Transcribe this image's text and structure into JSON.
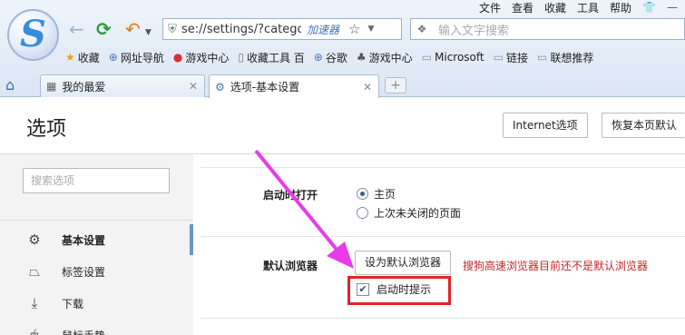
{
  "menubar": {
    "items": [
      "文件",
      "查看",
      "收藏",
      "工具",
      "帮助"
    ]
  },
  "address": {
    "url": "se://settings/?catego",
    "accelerator": "加速器"
  },
  "search": {
    "placeholder": "输入文字搜索"
  },
  "bookmarks": [
    {
      "label": "收藏",
      "icon": "star-icon"
    },
    {
      "label": "网址导航",
      "icon": "globe-icon"
    },
    {
      "label": "游戏中心",
      "icon": "game-icon"
    },
    {
      "label": "收藏工具 百",
      "icon": "page-icon"
    },
    {
      "label": "谷歌",
      "icon": "globe-icon"
    },
    {
      "label": "游戏中心",
      "icon": "gamepad-icon"
    },
    {
      "label": "Microsoft",
      "icon": "folder-icon"
    },
    {
      "label": "链接",
      "icon": "folder-icon"
    },
    {
      "label": "联想推荐",
      "icon": "folder-icon"
    }
  ],
  "tabs": [
    {
      "label": "我的最爱"
    },
    {
      "label": "选项-基本设置"
    }
  ],
  "page": {
    "title": "选项",
    "ie_options_btn": "Internet选项",
    "restore_btn": "恢复本页默认"
  },
  "sidebar": {
    "search_placeholder": "搜索选项",
    "items": [
      {
        "label": "基本设置",
        "icon": "gear-icon",
        "active": true
      },
      {
        "label": "标签设置",
        "icon": "tab-icon",
        "active": false
      },
      {
        "label": "下载",
        "icon": "download-icon",
        "active": false
      },
      {
        "label": "鼠标手势",
        "icon": "mouse-icon",
        "active": false
      }
    ]
  },
  "settings": {
    "startup": {
      "label": "启动时打开",
      "options": [
        "主页",
        "上次未关闭的页面"
      ],
      "selected": 0
    },
    "default_browser": {
      "label": "默认浏览器",
      "button": "设为默认浏览器",
      "warning": "搜狗高速浏览器目前还不是默认浏览器",
      "checkbox_label": "启动时提示",
      "checked": true
    }
  },
  "colors": {
    "accent": "#6f95c4",
    "warning": "#c0282a",
    "highlight_box": "#e0242a",
    "arrow": "#e83ce8"
  }
}
